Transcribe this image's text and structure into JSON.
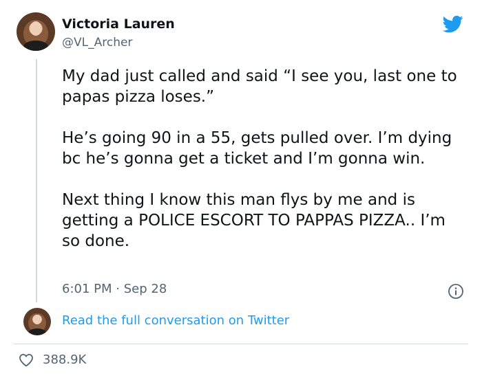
{
  "author": {
    "display_name": "Victoria Lauren",
    "handle": "@VL_Archer"
  },
  "tweet": {
    "paragraphs": [
      "My dad just called and said “I see you, last one to papas pizza loses.”",
      "He’s going 90 in a 55, gets pulled over. I’m dying bc he’s gonna get a ticket and I’m gonna win.",
      "Next thing I know this man flys by me and is getting a POLICE ESCORT TO PAPPAS PIZZA.. I’m so done."
    ],
    "time": "6:01 PM",
    "separator": "·",
    "date": "Sep 28"
  },
  "conversation_link": "Read the full conversation on Twitter",
  "likes": "388.9K",
  "icons": {
    "brand": "twitter-bird-icon",
    "info": "info-icon",
    "like": "heart-icon"
  },
  "colors": {
    "brand": "#1d9bf0",
    "text": "#0f1419",
    "secondary": "#536471",
    "line": "#cfd9de"
  }
}
